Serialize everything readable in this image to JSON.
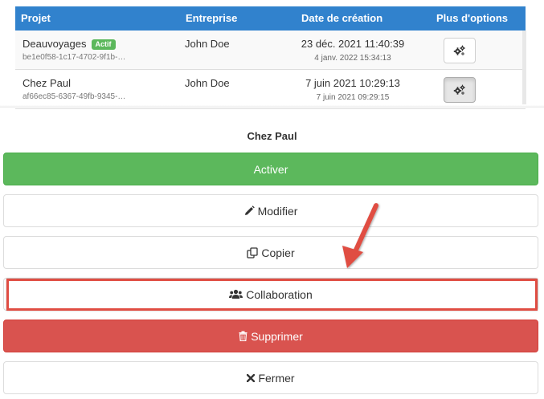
{
  "table": {
    "headers": [
      "Projet",
      "Entreprise",
      "Date de création",
      "Plus d'options"
    ],
    "rows": [
      {
        "name": "Deauvoyages",
        "badge": "Actif",
        "id": "be1e0f58-1c17-4702-9f1b-…",
        "company": "John Doe",
        "created": "23 déc. 2021 11:40:39",
        "modified": "4 janv. 2022 15:34:13",
        "options_icon": "gears-icon"
      },
      {
        "name": "Chez Paul",
        "badge": "",
        "id": "af66ec85-6367-49fb-9345-…",
        "company": "John Doe",
        "created": "7 juin 2021 10:29:13",
        "modified": "7 juin 2021 09:29:15",
        "options_icon": "gears-icon"
      }
    ]
  },
  "modal": {
    "title": "Chez Paul",
    "buttons": {
      "activer": {
        "label": "Activer",
        "color": "#5cb85c"
      },
      "modifier": {
        "label": "Modifier",
        "icon": "pencil-icon"
      },
      "copier": {
        "label": "Copier",
        "icon": "copy-icon"
      },
      "collaboration": {
        "label": "Collaboration",
        "icon": "users-icon"
      },
      "supprimer": {
        "label": "Supprimer",
        "icon": "trash-icon",
        "color": "#d9534f"
      },
      "fermer": {
        "label": "Fermer",
        "icon": "close-icon"
      }
    }
  },
  "annotation": {
    "color": "#e04d43",
    "target": "collaboration-button"
  },
  "colors": {
    "header": "#3182cd",
    "success": "#5cb85c",
    "danger": "#d9534f"
  }
}
